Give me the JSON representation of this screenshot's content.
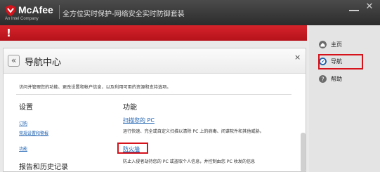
{
  "app": {
    "brand": "McAfee",
    "brand_sub": "An Intel Company",
    "window_title": "全方位实时保护-网络安全实时防御套装",
    "alert_symbol": "!"
  },
  "colors": {
    "titlebar": "#333333",
    "alert": "#c8161e",
    "highlight_box": "#d6121b",
    "link": "#1a5fb0"
  },
  "sidebar": {
    "items": [
      {
        "label": "主页",
        "icon": "home-icon"
      },
      {
        "label": "导航",
        "icon": "compass-icon"
      },
      {
        "label": "帮助",
        "icon": "help-icon"
      }
    ]
  },
  "panel": {
    "title": "导航中心",
    "back_glyph": "«",
    "close_glyph": "×",
    "intro": "访问并管理您的功能、更改设置和帐户信息，以及利用可用的资源和支持选项。",
    "settings": {
      "heading": "设置",
      "links": [
        "订购",
        "常规设置和警报",
        "功能"
      ]
    },
    "reports": {
      "heading": "报告和历史记录"
    },
    "features": {
      "heading": "功能",
      "items": [
        {
          "label": "扫描您的 PC",
          "desc": "运行快速、完全或自定义扫描以清除 PC 上的病毒、间谍软件和其他威胁。"
        },
        {
          "label": "防火墙",
          "desc": "防止入侵者劫持您的 PC 或盗取个人信息，并控制由您 PC 收发的信息"
        }
      ]
    }
  }
}
